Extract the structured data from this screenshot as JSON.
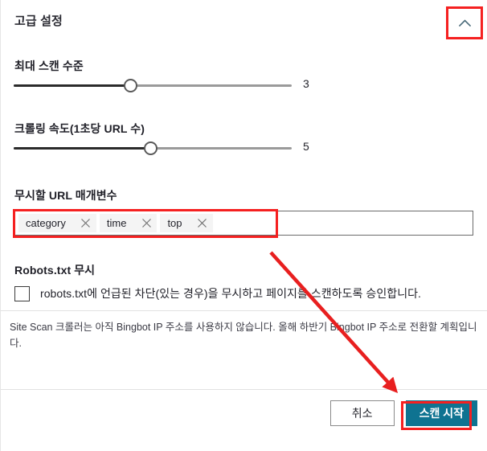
{
  "section": {
    "title": "고급 설정",
    "collapse_icon": "chevron-up-icon"
  },
  "fields": {
    "max_scan_depth": {
      "label": "최대 스캔 수준",
      "value": "3",
      "fill_percent": 42
    },
    "crawl_speed": {
      "label": "크롤링 속도(1초당 URL 수)",
      "value": "5",
      "fill_percent": 49
    },
    "ignore_url_params": {
      "label": "무시할 URL 매개변수",
      "chips": [
        {
          "label": "category",
          "remove_icon": "close-icon"
        },
        {
          "label": "time",
          "remove_icon": "close-icon"
        },
        {
          "label": "top",
          "remove_icon": "close-icon"
        }
      ],
      "placeholder": ""
    },
    "ignore_robots": {
      "label": "Robots.txt 무시",
      "checkbox_label": "robots.txt에 언급된 차단(있는 경우)을 무시하고 페이지를 스캔하도록 승인합니다.",
      "checked": false
    }
  },
  "note": "Site Scan 크롤러는 아직 Bingbot IP 주소를 사용하지 않습니다. 올해 하반기 Bingbot IP 주소로 전환할 계획입니다.",
  "footer": {
    "cancel_label": "취소",
    "start_scan_label": "스캔 시작"
  },
  "colors": {
    "primary_button": "#0f7391",
    "annotation": "#f52020",
    "slider_fill": "#2b2b2b",
    "slider_track": "#9a9a9a"
  }
}
